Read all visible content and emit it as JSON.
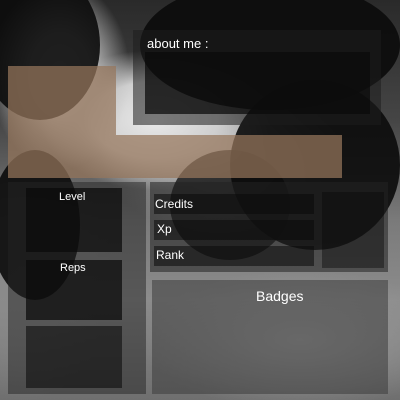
{
  "profile": {
    "about_title": "about me :",
    "level_label": "Level",
    "credits_label": "Credits",
    "xp_label": "Xp",
    "rank_label": "Rank",
    "reps_label": "Reps",
    "badges_label": "Badges"
  },
  "colors": {
    "overlay_dark": "#0a0a0a",
    "overlay_gray": "#282828",
    "accent_tan": "#96765c",
    "text": "#ffffff"
  }
}
